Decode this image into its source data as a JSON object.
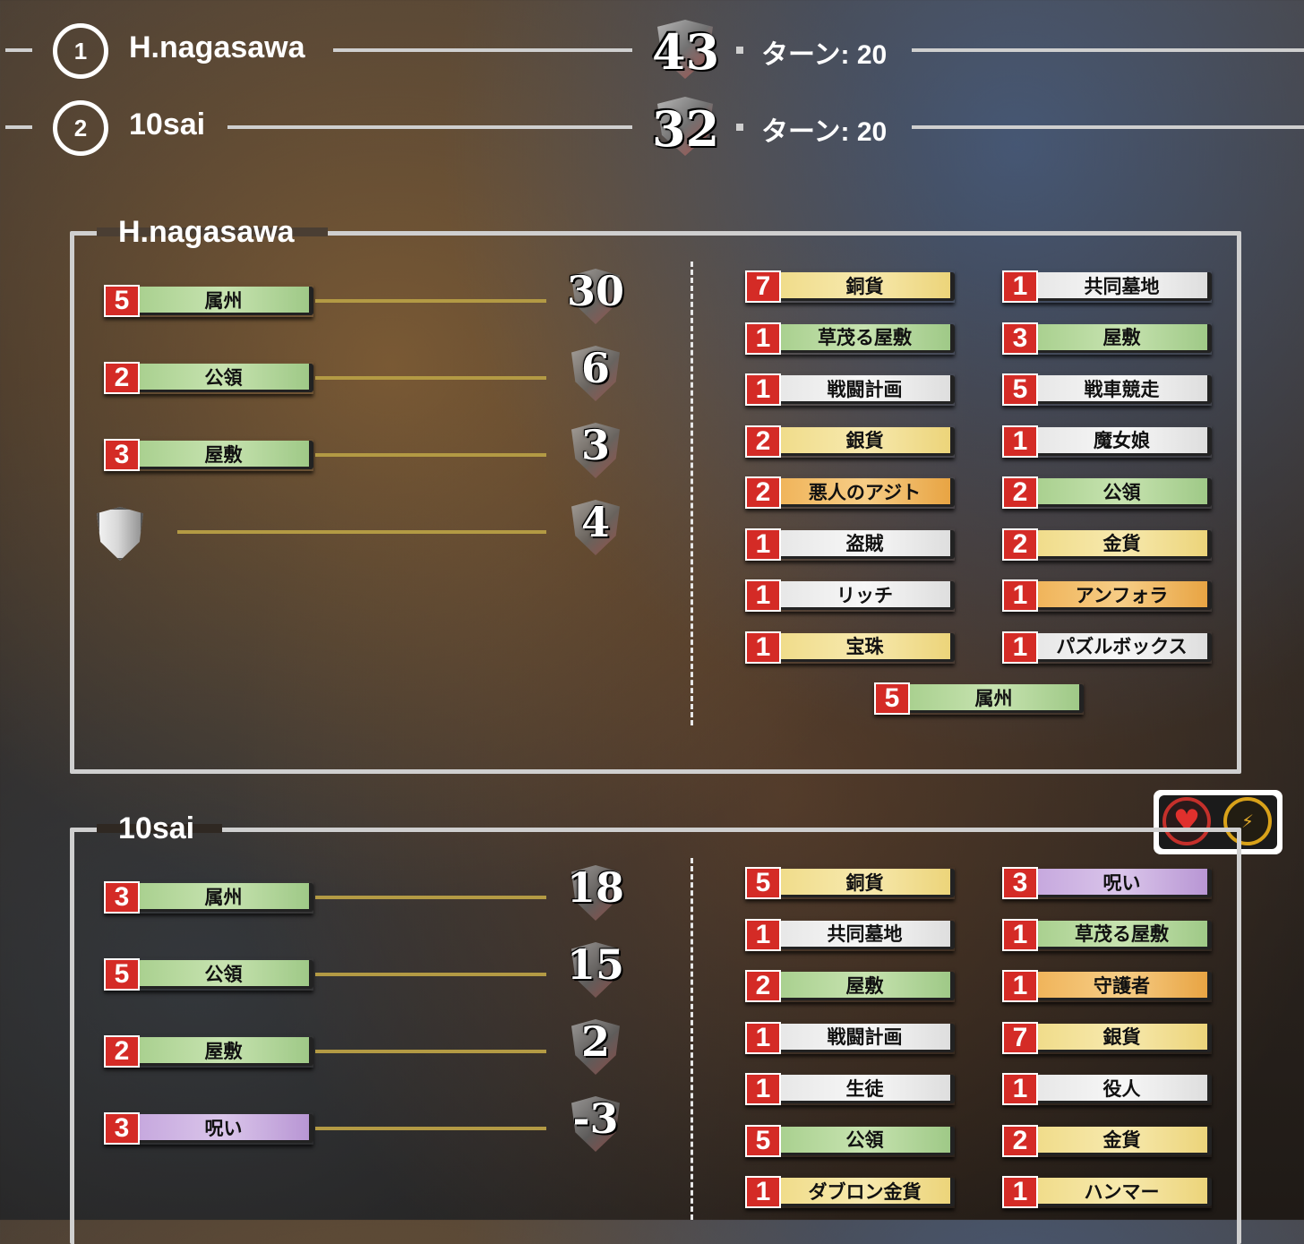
{
  "ranking": [
    {
      "rank": "1",
      "name": "H.nagasawa",
      "score": "43",
      "turn_label": "ターン: 20"
    },
    {
      "rank": "2",
      "name": "10sai",
      "score": "32",
      "turn_label": "ターン: 20"
    }
  ],
  "players": [
    {
      "name": "H.nagasawa",
      "victory_rows": [
        {
          "count": "5",
          "label": "属州",
          "color": "green",
          "score": "30"
        },
        {
          "count": "2",
          "label": "公領",
          "color": "green",
          "score": "6"
        },
        {
          "count": "3",
          "label": "屋敷",
          "color": "green",
          "score": "3"
        },
        {
          "icon": "vp-token-icon",
          "score": "4"
        }
      ],
      "deck": [
        {
          "count": "7",
          "label": "銅貨",
          "color": "yellow"
        },
        {
          "count": "1",
          "label": "共同墓地",
          "color": "white"
        },
        {
          "count": "1",
          "label": "草茂る屋敷",
          "color": "green"
        },
        {
          "count": "3",
          "label": "屋敷",
          "color": "green"
        },
        {
          "count": "1",
          "label": "戦闘計画",
          "color": "white"
        },
        {
          "count": "5",
          "label": "戦車競走",
          "color": "white"
        },
        {
          "count": "2",
          "label": "銀貨",
          "color": "yellow"
        },
        {
          "count": "1",
          "label": "魔女娘",
          "color": "white"
        },
        {
          "count": "2",
          "label": "悪人のアジト",
          "color": "orange"
        },
        {
          "count": "2",
          "label": "公領",
          "color": "green"
        },
        {
          "count": "1",
          "label": "盗賊",
          "color": "white"
        },
        {
          "count": "2",
          "label": "金貨",
          "color": "yellow"
        },
        {
          "count": "1",
          "label": "リッチ",
          "color": "white"
        },
        {
          "count": "1",
          "label": "アンフォラ",
          "color": "orange"
        },
        {
          "count": "1",
          "label": "宝珠",
          "color": "yellow"
        },
        {
          "count": "1",
          "label": "パズルボックス",
          "color": "white"
        },
        {
          "count": "5",
          "label": "属州",
          "color": "green"
        }
      ]
    },
    {
      "name": "10sai",
      "victory_rows": [
        {
          "count": "3",
          "label": "属州",
          "color": "green",
          "score": "18"
        },
        {
          "count": "5",
          "label": "公領",
          "color": "green",
          "score": "15"
        },
        {
          "count": "2",
          "label": "屋敷",
          "color": "green",
          "score": "2"
        },
        {
          "count": "3",
          "label": "呪い",
          "color": "purple",
          "score": "-3"
        }
      ],
      "deck": [
        {
          "count": "5",
          "label": "銅貨",
          "color": "yellow"
        },
        {
          "count": "3",
          "label": "呪い",
          "color": "purple"
        },
        {
          "count": "1",
          "label": "共同墓地",
          "color": "white"
        },
        {
          "count": "1",
          "label": "草茂る屋敷",
          "color": "green"
        },
        {
          "count": "2",
          "label": "屋敷",
          "color": "green"
        },
        {
          "count": "1",
          "label": "守護者",
          "color": "orange"
        },
        {
          "count": "1",
          "label": "戦闘計画",
          "color": "white"
        },
        {
          "count": "7",
          "label": "銀貨",
          "color": "yellow"
        },
        {
          "count": "1",
          "label": "生徒",
          "color": "white"
        },
        {
          "count": "1",
          "label": "役人",
          "color": "white"
        },
        {
          "count": "5",
          "label": "公領",
          "color": "green"
        },
        {
          "count": "2",
          "label": "金貨",
          "color": "yellow"
        },
        {
          "count": "1",
          "label": "ダブロン金貨",
          "color": "yellow"
        },
        {
          "count": "1",
          "label": "ハンマー",
          "color": "yellow"
        }
      ]
    }
  ],
  "status_icons": [
    "heart-icon",
    "bolt-icon"
  ],
  "colors": {
    "count_badge": "#d42b26",
    "green": "#b5d99c",
    "yellow": "#f3e29a",
    "white": "#eeeeee",
    "orange": "#f1b860",
    "purple": "#cfb4e4"
  }
}
